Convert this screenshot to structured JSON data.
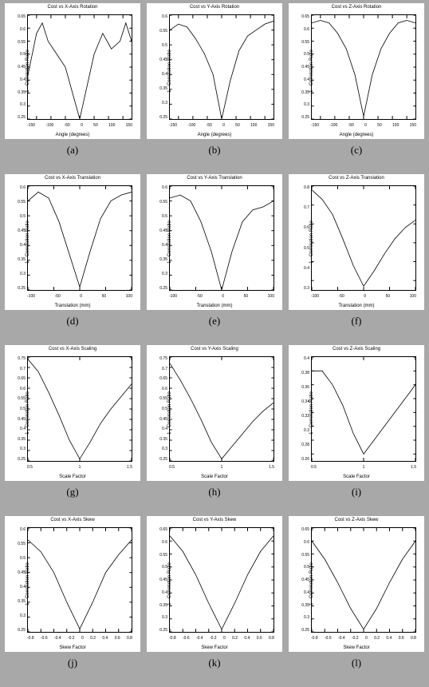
{
  "chart_data": [
    {
      "id": "a",
      "caption": "(a)",
      "title": "Cost vs X-Axis Rotation",
      "xlabel": "Angle (degrees)",
      "ylabel": "1 - Correlation Ratio",
      "type": "line",
      "xlim": [
        -180,
        180
      ],
      "ylim": [
        0.25,
        0.65
      ],
      "x_ticks": [
        "-150",
        "-100",
        "-50",
        "0",
        "50",
        "100",
        "150"
      ],
      "y_ticks": [
        "0.65",
        "0.6",
        "0.55",
        "0.5",
        "0.45",
        "0.4",
        "0.35",
        "0.3",
        "0.25"
      ],
      "x": [
        -180,
        -150,
        -130,
        -110,
        -80,
        -50,
        -20,
        0,
        20,
        50,
        80,
        110,
        140,
        160,
        180
      ],
      "y": [
        0.42,
        0.58,
        0.62,
        0.55,
        0.5,
        0.45,
        0.33,
        0.25,
        0.35,
        0.5,
        0.58,
        0.52,
        0.55,
        0.62,
        0.55
      ]
    },
    {
      "id": "b",
      "caption": "(b)",
      "title": "Cost vs Y-Axis Rotation",
      "xlabel": "Angle (degrees)",
      "ylabel": "1 - Correlation Ratio",
      "type": "line",
      "xlim": [
        -180,
        180
      ],
      "ylim": [
        0.25,
        0.6
      ],
      "x_ticks": [
        "-150",
        "-100",
        "-50",
        "0",
        "50",
        "100",
        "150"
      ],
      "y_ticks": [
        "0.6",
        "0.55",
        "0.5",
        "0.45",
        "0.4",
        "0.35",
        "0.3",
        "0.25"
      ],
      "x": [
        -180,
        -150,
        -120,
        -90,
        -60,
        -30,
        0,
        30,
        60,
        90,
        120,
        150,
        180
      ],
      "y": [
        0.55,
        0.57,
        0.56,
        0.52,
        0.47,
        0.4,
        0.25,
        0.38,
        0.48,
        0.53,
        0.55,
        0.57,
        0.58
      ]
    },
    {
      "id": "c",
      "caption": "(c)",
      "title": "Cost vs Z-Axis Rotation",
      "xlabel": "Angle (degrees)",
      "ylabel": "1 - Correlation Ratio",
      "type": "line",
      "xlim": [
        -180,
        180
      ],
      "ylim": [
        0.25,
        0.65
      ],
      "x_ticks": [
        "-150",
        "-100",
        "-50",
        "0",
        "50",
        "100",
        "150"
      ],
      "y_ticks": [
        "0.65",
        "0.6",
        "0.55",
        "0.5",
        "0.45",
        "0.4",
        "0.35",
        "0.3",
        "0.25"
      ],
      "x": [
        -180,
        -150,
        -120,
        -90,
        -60,
        -30,
        0,
        30,
        60,
        90,
        120,
        150,
        180
      ],
      "y": [
        0.62,
        0.63,
        0.62,
        0.58,
        0.52,
        0.42,
        0.26,
        0.42,
        0.52,
        0.58,
        0.62,
        0.63,
        0.62
      ]
    },
    {
      "id": "d",
      "caption": "(d)",
      "title": "Cost vs X-Axis Translation",
      "xlabel": "Translation (mm)",
      "ylabel": "1 - Correlation Ratio",
      "type": "line",
      "xlim": [
        -100,
        100
      ],
      "ylim": [
        0.25,
        0.6
      ],
      "x_ticks": [
        "-100",
        "-50",
        "0",
        "50",
        "100"
      ],
      "y_ticks": [
        "0.6",
        "0.55",
        "0.5",
        "0.45",
        "0.4",
        "0.35",
        "0.3",
        "0.25"
      ],
      "x": [
        -100,
        -80,
        -60,
        -40,
        -20,
        0,
        20,
        40,
        60,
        80,
        100
      ],
      "y": [
        0.55,
        0.58,
        0.56,
        0.48,
        0.37,
        0.26,
        0.38,
        0.49,
        0.55,
        0.57,
        0.58
      ]
    },
    {
      "id": "e",
      "caption": "(e)",
      "title": "Cost vs Y-Axis Translation",
      "xlabel": "Translation (mm)",
      "ylabel": "1 - Correlation Ratio",
      "type": "line",
      "xlim": [
        -100,
        100
      ],
      "ylim": [
        0.25,
        0.6
      ],
      "x_ticks": [
        "-100",
        "-50",
        "0",
        "50",
        "100"
      ],
      "y_ticks": [
        "0.6",
        "0.55",
        "0.5",
        "0.45",
        "0.4",
        "0.35",
        "0.3",
        "0.25"
      ],
      "x": [
        -100,
        -80,
        -60,
        -40,
        -20,
        0,
        20,
        40,
        60,
        80,
        100
      ],
      "y": [
        0.56,
        0.57,
        0.55,
        0.48,
        0.38,
        0.25,
        0.38,
        0.48,
        0.52,
        0.53,
        0.55
      ]
    },
    {
      "id": "f",
      "caption": "(f)",
      "title": "Cost vs Z-Axis Translation",
      "xlabel": "Translation (mm)",
      "ylabel": "1 - Correlation Ratio",
      "type": "line",
      "xlim": [
        -100,
        100
      ],
      "ylim": [
        0.25,
        0.8
      ],
      "x_ticks": [
        "-100",
        "-50",
        "0",
        "50",
        "100"
      ],
      "y_ticks": [
        "0.8",
        "0.7",
        "0.6",
        "0.5",
        "0.4",
        "0.3"
      ],
      "x": [
        -100,
        -80,
        -60,
        -40,
        -20,
        0,
        20,
        40,
        60,
        80,
        100
      ],
      "y": [
        0.78,
        0.73,
        0.65,
        0.52,
        0.38,
        0.27,
        0.35,
        0.44,
        0.52,
        0.58,
        0.62
      ]
    },
    {
      "id": "g",
      "caption": "(g)",
      "title": "Cost vs X-Axis Scaling",
      "xlabel": "Scale Factor",
      "ylabel": "1 - Correlation Ratio",
      "type": "line",
      "xlim": [
        0.5,
        1.5
      ],
      "ylim": [
        0.25,
        0.75
      ],
      "x_ticks": [
        "0.5",
        "1",
        "1.5"
      ],
      "y_ticks": [
        "0.75",
        "0.7",
        "0.65",
        "0.6",
        "0.55",
        "0.5",
        "0.45",
        "0.4",
        "0.35",
        "0.3",
        "0.25"
      ],
      "x": [
        0.5,
        0.6,
        0.7,
        0.8,
        0.9,
        1.0,
        1.1,
        1.2,
        1.3,
        1.4,
        1.5
      ],
      "y": [
        0.74,
        0.68,
        0.58,
        0.47,
        0.35,
        0.26,
        0.34,
        0.43,
        0.5,
        0.56,
        0.62
      ]
    },
    {
      "id": "h",
      "caption": "(h)",
      "title": "Cost vs Y-Axis Scaling",
      "xlabel": "Scale Factor",
      "ylabel": "1 - Correlation Ratio",
      "type": "line",
      "xlim": [
        0.5,
        1.5
      ],
      "ylim": [
        0.25,
        0.75
      ],
      "x_ticks": [
        "0.5",
        "1",
        "1.5"
      ],
      "y_ticks": [
        "0.75",
        "0.7",
        "0.65",
        "0.6",
        "0.55",
        "0.5",
        "0.45",
        "0.4",
        "0.35",
        "0.3",
        "0.25"
      ],
      "x": [
        0.5,
        0.6,
        0.7,
        0.8,
        0.9,
        1.0,
        1.1,
        1.2,
        1.3,
        1.4,
        1.5
      ],
      "y": [
        0.72,
        0.64,
        0.55,
        0.45,
        0.34,
        0.26,
        0.32,
        0.38,
        0.44,
        0.49,
        0.53
      ]
    },
    {
      "id": "i",
      "caption": "(i)",
      "title": "Cost vs Z-Axis Scaling",
      "xlabel": "Scale Factor",
      "ylabel": "1 - Correlation Ratio",
      "type": "line",
      "xlim": [
        0.5,
        1.5
      ],
      "ylim": [
        0.25,
        0.4
      ],
      "x_ticks": [
        "0.5",
        "1",
        "1.5"
      ],
      "y_ticks": [
        "0.4",
        "0.38",
        "0.36",
        "0.34",
        "0.32",
        "0.3",
        "0.28",
        "0.26"
      ],
      "x": [
        0.5,
        0.6,
        0.7,
        0.8,
        0.9,
        1.0,
        1.1,
        1.2,
        1.3,
        1.4,
        1.5
      ],
      "y": [
        0.38,
        0.38,
        0.36,
        0.33,
        0.29,
        0.26,
        0.28,
        0.3,
        0.32,
        0.34,
        0.36
      ]
    },
    {
      "id": "j",
      "caption": "(j)",
      "title": "Cost vs X-Axis Skew",
      "xlabel": "Skew Factor",
      "ylabel": "1 - Correlation Ratio",
      "type": "line",
      "xlim": [
        -0.8,
        0.8
      ],
      "ylim": [
        0.25,
        0.6
      ],
      "x_ticks": [
        "-0.8",
        "-0.6",
        "-0.4",
        "-0.2",
        "0",
        "0.2",
        "0.4",
        "0.6",
        "0.8"
      ],
      "y_ticks": [
        "0.6",
        "0.55",
        "0.5",
        "0.45",
        "0.4",
        "0.35",
        "0.3",
        "0.25"
      ],
      "x": [
        -0.8,
        -0.6,
        -0.4,
        -0.2,
        0,
        0.2,
        0.4,
        0.6,
        0.8
      ],
      "y": [
        0.56,
        0.52,
        0.45,
        0.35,
        0.26,
        0.35,
        0.45,
        0.51,
        0.56
      ]
    },
    {
      "id": "k",
      "caption": "(k)",
      "title": "Cost vs Y-Axis Skew",
      "xlabel": "Skew Factor",
      "ylabel": "1 - Correlation Ratio",
      "type": "line",
      "xlim": [
        -0.8,
        0.8
      ],
      "ylim": [
        0.25,
        0.65
      ],
      "x_ticks": [
        "-0.8",
        "-0.6",
        "-0.4",
        "-0.2",
        "0",
        "0.2",
        "0.4",
        "0.6",
        "0.8"
      ],
      "y_ticks": [
        "0.65",
        "0.6",
        "0.55",
        "0.5",
        "0.45",
        "0.4",
        "0.35",
        "0.3",
        "0.25"
      ],
      "x": [
        -0.8,
        -0.6,
        -0.4,
        -0.2,
        0,
        0.2,
        0.4,
        0.6,
        0.8
      ],
      "y": [
        0.62,
        0.56,
        0.47,
        0.36,
        0.26,
        0.36,
        0.47,
        0.56,
        0.62
      ]
    },
    {
      "id": "l",
      "caption": "(l)",
      "title": "Cost vs Z-Axis Skew",
      "xlabel": "Skew Factor",
      "ylabel": "1 - Correlation Ratio",
      "type": "line",
      "xlim": [
        -0.8,
        0.8
      ],
      "ylim": [
        0.25,
        0.65
      ],
      "x_ticks": [
        "-0.8",
        "-0.6",
        "-0.4",
        "-0.2",
        "0",
        "0.2",
        "0.4",
        "0.6",
        "0.8"
      ],
      "y_ticks": [
        "0.65",
        "0.6",
        "0.55",
        "0.5",
        "0.45",
        "0.4",
        "0.35",
        "0.3",
        "0.25"
      ],
      "x": [
        -0.8,
        -0.6,
        -0.4,
        -0.2,
        0,
        0.2,
        0.4,
        0.6,
        0.8
      ],
      "y": [
        0.6,
        0.53,
        0.44,
        0.34,
        0.26,
        0.34,
        0.44,
        0.53,
        0.6
      ]
    }
  ]
}
